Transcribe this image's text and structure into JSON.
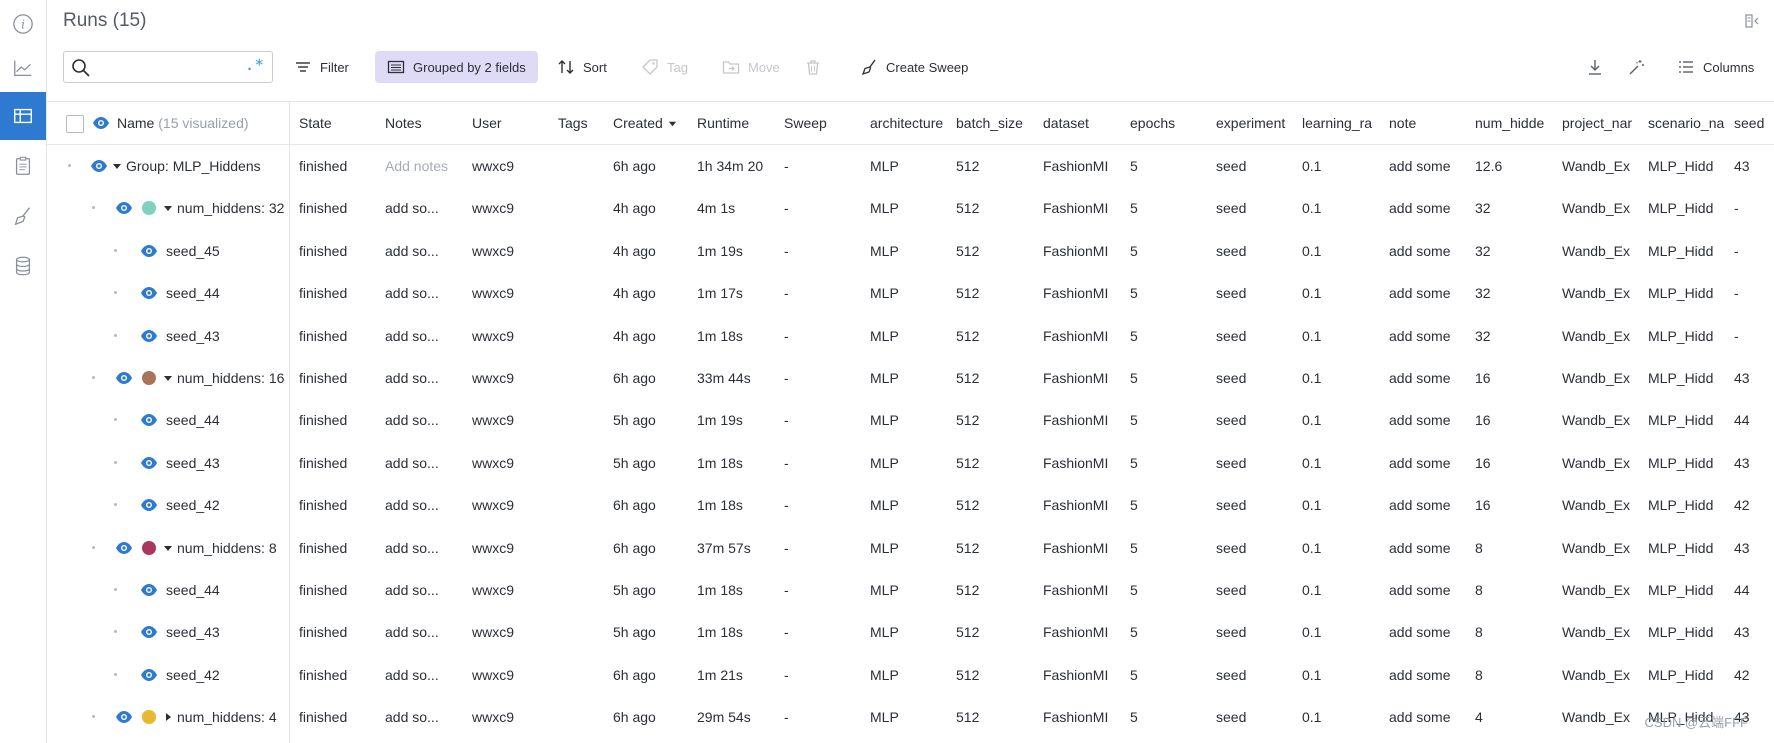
{
  "page": {
    "title": "Runs (15)",
    "watermark": "CSDN @云端FFF"
  },
  "rail": {
    "items": [
      {
        "name": "info-icon",
        "active": false
      },
      {
        "name": "chart-icon",
        "active": false
      },
      {
        "name": "table-icon",
        "active": true
      },
      {
        "name": "clipboard-icon",
        "active": false
      },
      {
        "name": "broom-icon",
        "active": false
      },
      {
        "name": "database-icon",
        "active": false
      }
    ]
  },
  "toolbar": {
    "search_placeholder": "",
    "regex_label": ".*",
    "filter_label": "Filter",
    "grouped_label": "Grouped by 2 fields",
    "sort_label": "Sort",
    "tag_label": "Tag",
    "move_label": "Move",
    "create_sweep_label": "Create Sweep",
    "columns_label": "Columns"
  },
  "table": {
    "name_header": "Name",
    "name_header_suffix": "(15 visualized)",
    "columns": [
      "State",
      "Notes",
      "User",
      "Tags",
      "Created",
      "Runtime",
      "Sweep",
      "architecture",
      "batch_size",
      "dataset",
      "epochs",
      "experiment",
      "learning_ra",
      "note",
      "num_hidde",
      "project_nar",
      "scenario_na",
      "seed"
    ],
    "rows": [
      {
        "level": 0,
        "kind": "group",
        "expanded": true,
        "color": null,
        "name": "Group: MLP_Hiddens",
        "cells": [
          "finished",
          "Add notes",
          "wwxc9",
          "",
          "6h ago",
          "1h 34m 20",
          "-",
          "MLP",
          "512",
          "FashionMI",
          "5",
          "seed",
          "0.1",
          "add some",
          "12.6",
          "Wandb_Ex",
          "MLP_Hidd",
          "43"
        ]
      },
      {
        "level": 1,
        "kind": "subgroup",
        "expanded": true,
        "color": "#7fd1c0",
        "name": "num_hiddens: 32",
        "cells": [
          "finished",
          "add so...",
          "wwxc9",
          "",
          "4h ago",
          "4m 1s",
          "-",
          "MLP",
          "512",
          "FashionMI",
          "5",
          "seed",
          "0.1",
          "add some",
          "32",
          "Wandb_Ex",
          "MLP_Hidd",
          "-"
        ]
      },
      {
        "level": 2,
        "kind": "run",
        "expanded": null,
        "color": null,
        "name": "seed_45",
        "cells": [
          "finished",
          "add so...",
          "wwxc9",
          "",
          "4h ago",
          "1m 19s",
          "-",
          "MLP",
          "512",
          "FashionMI",
          "5",
          "seed",
          "0.1",
          "add some",
          "32",
          "Wandb_Ex",
          "MLP_Hidd",
          "-"
        ]
      },
      {
        "level": 2,
        "kind": "run",
        "expanded": null,
        "color": null,
        "name": "seed_44",
        "cells": [
          "finished",
          "add so...",
          "wwxc9",
          "",
          "4h ago",
          "1m 17s",
          "-",
          "MLP",
          "512",
          "FashionMI",
          "5",
          "seed",
          "0.1",
          "add some",
          "32",
          "Wandb_Ex",
          "MLP_Hidd",
          "-"
        ]
      },
      {
        "level": 2,
        "kind": "run",
        "expanded": null,
        "color": null,
        "name": "seed_43",
        "cells": [
          "finished",
          "add so...",
          "wwxc9",
          "",
          "4h ago",
          "1m 18s",
          "-",
          "MLP",
          "512",
          "FashionMI",
          "5",
          "seed",
          "0.1",
          "add some",
          "32",
          "Wandb_Ex",
          "MLP_Hidd",
          "-"
        ]
      },
      {
        "level": 1,
        "kind": "subgroup",
        "expanded": true,
        "color": "#a8745a",
        "name": "num_hiddens: 16",
        "cells": [
          "finished",
          "add so...",
          "wwxc9",
          "",
          "6h ago",
          "33m 44s",
          "-",
          "MLP",
          "512",
          "FashionMI",
          "5",
          "seed",
          "0.1",
          "add some",
          "16",
          "Wandb_Ex",
          "MLP_Hidd",
          "43"
        ]
      },
      {
        "level": 2,
        "kind": "run",
        "expanded": null,
        "color": null,
        "name": "seed_44",
        "cells": [
          "finished",
          "add so...",
          "wwxc9",
          "",
          "5h ago",
          "1m 19s",
          "-",
          "MLP",
          "512",
          "FashionMI",
          "5",
          "seed",
          "0.1",
          "add some",
          "16",
          "Wandb_Ex",
          "MLP_Hidd",
          "44"
        ]
      },
      {
        "level": 2,
        "kind": "run",
        "expanded": null,
        "color": null,
        "name": "seed_43",
        "cells": [
          "finished",
          "add so...",
          "wwxc9",
          "",
          "5h ago",
          "1m 18s",
          "-",
          "MLP",
          "512",
          "FashionMI",
          "5",
          "seed",
          "0.1",
          "add some",
          "16",
          "Wandb_Ex",
          "MLP_Hidd",
          "43"
        ]
      },
      {
        "level": 2,
        "kind": "run",
        "expanded": null,
        "color": null,
        "name": "seed_42",
        "cells": [
          "finished",
          "add so...",
          "wwxc9",
          "",
          "6h ago",
          "1m 18s",
          "-",
          "MLP",
          "512",
          "FashionMI",
          "5",
          "seed",
          "0.1",
          "add some",
          "16",
          "Wandb_Ex",
          "MLP_Hidd",
          "42"
        ]
      },
      {
        "level": 1,
        "kind": "subgroup",
        "expanded": true,
        "color": "#a8365f",
        "name": "num_hiddens: 8",
        "cells": [
          "finished",
          "add so...",
          "wwxc9",
          "",
          "6h ago",
          "37m 57s",
          "-",
          "MLP",
          "512",
          "FashionMI",
          "5",
          "seed",
          "0.1",
          "add some",
          "8",
          "Wandb_Ex",
          "MLP_Hidd",
          "43"
        ]
      },
      {
        "level": 2,
        "kind": "run",
        "expanded": null,
        "color": null,
        "name": "seed_44",
        "cells": [
          "finished",
          "add so...",
          "wwxc9",
          "",
          "5h ago",
          "1m 18s",
          "-",
          "MLP",
          "512",
          "FashionMI",
          "5",
          "seed",
          "0.1",
          "add some",
          "8",
          "Wandb_Ex",
          "MLP_Hidd",
          "44"
        ]
      },
      {
        "level": 2,
        "kind": "run",
        "expanded": null,
        "color": null,
        "name": "seed_43",
        "cells": [
          "finished",
          "add so...",
          "wwxc9",
          "",
          "5h ago",
          "1m 18s",
          "-",
          "MLP",
          "512",
          "FashionMI",
          "5",
          "seed",
          "0.1",
          "add some",
          "8",
          "Wandb_Ex",
          "MLP_Hidd",
          "43"
        ]
      },
      {
        "level": 2,
        "kind": "run",
        "expanded": null,
        "color": null,
        "name": "seed_42",
        "cells": [
          "finished",
          "add so...",
          "wwxc9",
          "",
          "6h ago",
          "1m 21s",
          "-",
          "MLP",
          "512",
          "FashionMI",
          "5",
          "seed",
          "0.1",
          "add some",
          "8",
          "Wandb_Ex",
          "MLP_Hidd",
          "42"
        ]
      },
      {
        "level": 1,
        "kind": "subgroup",
        "expanded": false,
        "color": "#e8b82e",
        "name": "num_hiddens: 4",
        "cells": [
          "finished",
          "add so...",
          "wwxc9",
          "",
          "6h ago",
          "29m 54s",
          "-",
          "MLP",
          "512",
          "FashionMI",
          "5",
          "seed",
          "0.1",
          "add some",
          "4",
          "Wandb_Ex",
          "MLP_Hidd",
          "43"
        ]
      }
    ]
  }
}
